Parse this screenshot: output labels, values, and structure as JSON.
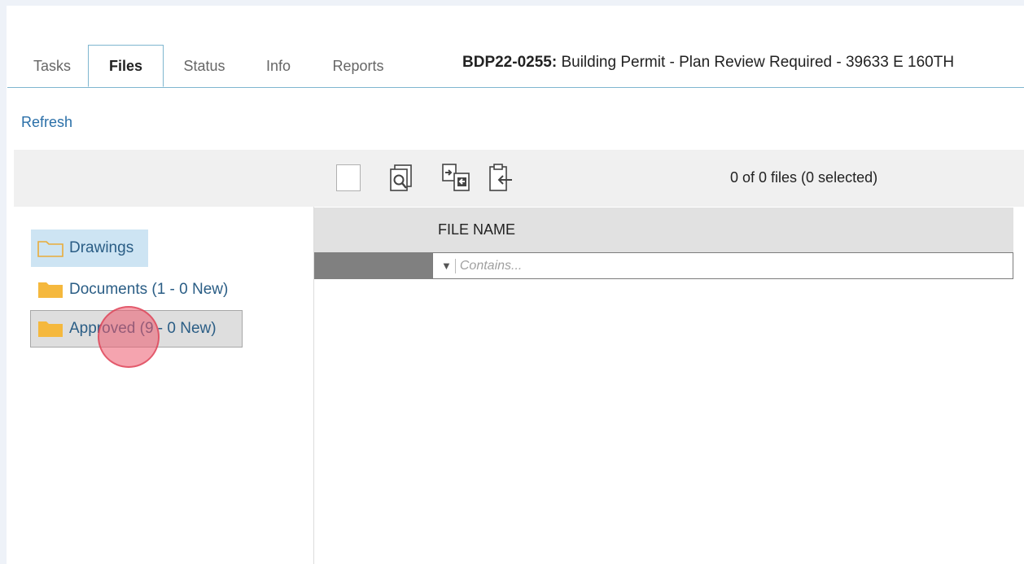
{
  "tabs": [
    {
      "label": "Tasks"
    },
    {
      "label": "Files",
      "active": true
    },
    {
      "label": "Status"
    },
    {
      "label": "Info"
    },
    {
      "label": "Reports"
    }
  ],
  "header": {
    "permit_id": "BDP22-0255:",
    "permit_desc": "Building Permit - Plan Review Required - 39633 E 160TH"
  },
  "actions": {
    "refresh_label": "Refresh"
  },
  "toolbar": {
    "file_count": "0 of 0 files (0 selected)",
    "icons": [
      "select-all-checkbox",
      "preview-icon",
      "transfer-in-icon",
      "transfer-out-icon"
    ]
  },
  "tree": {
    "items": [
      {
        "label": "Drawings",
        "state": "selected",
        "icon": "folder-outline-icon"
      },
      {
        "label": "Documents (1 - 0 New)",
        "state": "normal",
        "icon": "folder-icon"
      },
      {
        "label": "Approved (9 - 0 New)",
        "state": "hover",
        "icon": "folder-icon"
      }
    ]
  },
  "grid": {
    "column_file_name": "FILE NAME",
    "filter_placeholder": "Contains..."
  },
  "colors": {
    "accent_blue": "#2a6fa8",
    "tab_border": "#7fb6cf",
    "folder_yellow": "#f5b83d",
    "selected_bg": "#cde4f3",
    "click_marker": "#ec5a6e"
  }
}
